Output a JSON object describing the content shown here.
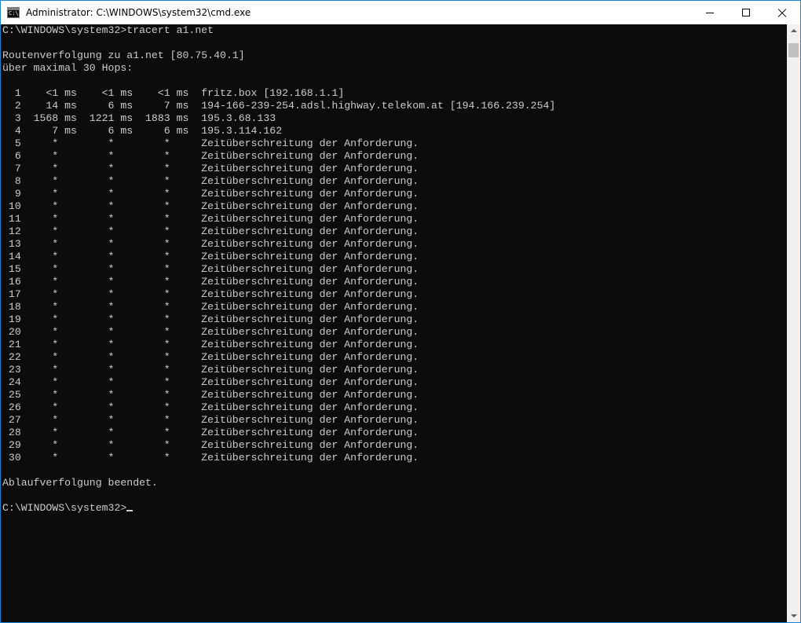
{
  "window": {
    "title": "Administrator: C:\\WINDOWS\\system32\\cmd.exe",
    "icon_text": "C:\\."
  },
  "console": {
    "lines": [
      "C:\\WINDOWS\\system32>tracert a1.net",
      "",
      "Routenverfolgung zu a1.net [80.75.40.1]",
      "über maximal 30 Hops:",
      "",
      "  1    <1 ms    <1 ms    <1 ms  fritz.box [192.168.1.1]",
      "  2    14 ms     6 ms     7 ms  194-166-239-254.adsl.highway.telekom.at [194.166.239.254]",
      "  3  1568 ms  1221 ms  1883 ms  195.3.68.133",
      "  4     7 ms     6 ms     6 ms  195.3.114.162",
      "  5     *        *        *     Zeitüberschreitung der Anforderung.",
      "  6     *        *        *     Zeitüberschreitung der Anforderung.",
      "  7     *        *        *     Zeitüberschreitung der Anforderung.",
      "  8     *        *        *     Zeitüberschreitung der Anforderung.",
      "  9     *        *        *     Zeitüberschreitung der Anforderung.",
      " 10     *        *        *     Zeitüberschreitung der Anforderung.",
      " 11     *        *        *     Zeitüberschreitung der Anforderung.",
      " 12     *        *        *     Zeitüberschreitung der Anforderung.",
      " 13     *        *        *     Zeitüberschreitung der Anforderung.",
      " 14     *        *        *     Zeitüberschreitung der Anforderung.",
      " 15     *        *        *     Zeitüberschreitung der Anforderung.",
      " 16     *        *        *     Zeitüberschreitung der Anforderung.",
      " 17     *        *        *     Zeitüberschreitung der Anforderung.",
      " 18     *        *        *     Zeitüberschreitung der Anforderung.",
      " 19     *        *        *     Zeitüberschreitung der Anforderung.",
      " 20     *        *        *     Zeitüberschreitung der Anforderung.",
      " 21     *        *        *     Zeitüberschreitung der Anforderung.",
      " 22     *        *        *     Zeitüberschreitung der Anforderung.",
      " 23     *        *        *     Zeitüberschreitung der Anforderung.",
      " 24     *        *        *     Zeitüberschreitung der Anforderung.",
      " 25     *        *        *     Zeitüberschreitung der Anforderung.",
      " 26     *        *        *     Zeitüberschreitung der Anforderung.",
      " 27     *        *        *     Zeitüberschreitung der Anforderung.",
      " 28     *        *        *     Zeitüberschreitung der Anforderung.",
      " 29     *        *        *     Zeitüberschreitung der Anforderung.",
      " 30     *        *        *     Zeitüberschreitung der Anforderung.",
      "",
      "Ablaufverfolgung beendet.",
      ""
    ],
    "prompt": "C:\\WINDOWS\\system32>"
  },
  "colors": {
    "background": "#0c0c0c",
    "foreground": "#cccccc",
    "window_border": "#1883d7"
  },
  "icons": {
    "app": "cmd-icon",
    "minimize": "minimize-icon",
    "maximize": "maximize-icon",
    "close": "close-icon"
  }
}
